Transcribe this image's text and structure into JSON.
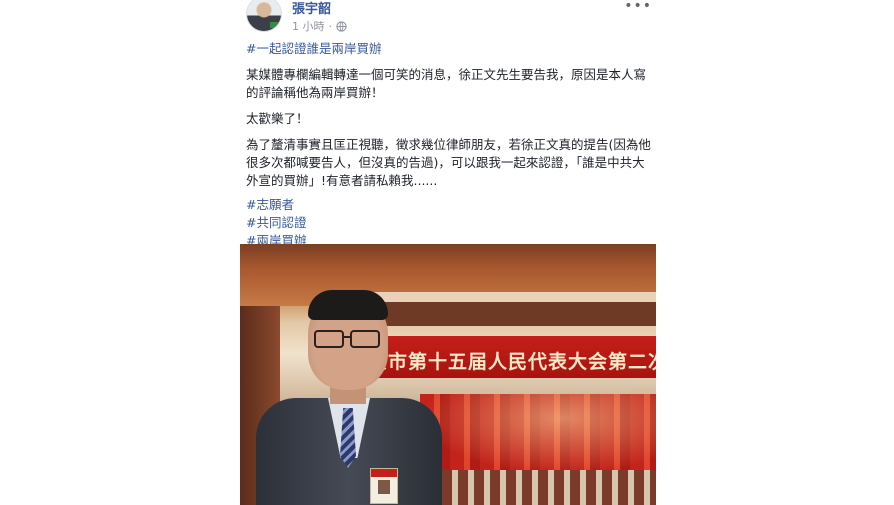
{
  "post": {
    "author": "張宇韶",
    "time": "1 小時",
    "dot": "·",
    "more": "•••",
    "hashtag_title": "#一起認證誰是兩岸買辦",
    "paragraph1": "某媒體專欄編輯轉達一個可笑的消息，徐正文先生要告我，原因是本人寫的評論稱他為兩岸買辦！",
    "paragraph2": "太歡樂了！",
    "paragraph3": "為了釐清事實且匡正視聽，徵求幾位律師朋友，若徐正文真的提告(因為他很多次都喊要告人，但沒真的告過)，可以跟我一起來認證，「誰是中共大外宣的買辦」!有意者請私賴我......",
    "tags": [
      "#志願者",
      "#共同認證",
      "#兩岸買辦"
    ]
  },
  "photo": {
    "banner_text": "京市第十五届人民代表大会第二次会议"
  },
  "icons": {
    "privacy": "globe-icon",
    "menu": "more-options-icon"
  },
  "colors": {
    "link": "#385898",
    "meta": "#90949c",
    "banner": "#c51f1a"
  }
}
